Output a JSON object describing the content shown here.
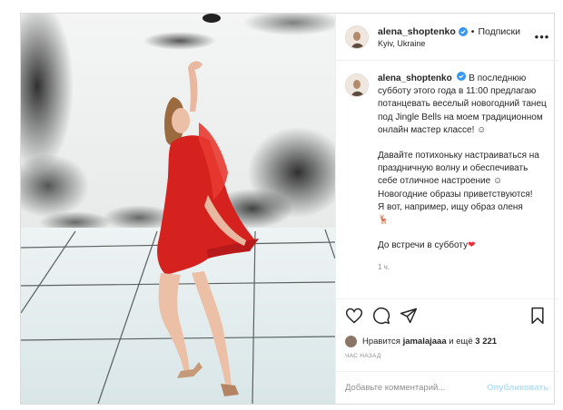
{
  "post": {
    "username": "alena_shoptenko",
    "separator": "•",
    "follow_label": "Подписки",
    "location": "Kyiv, Ukraine",
    "more_label": "•••",
    "caption_lines": [
      "В последнюю субботу этого года в 11:00 предлагаю потанцевать веселый новогодний танец под Jingle Bells на моем традиционном онлайн мастер классе! ☺",
      "",
      "Давайте потихоньку настраиваться на праздничную волну и обеспечивать себе отличное настроение ☺",
      "Новогодние образы приветствуются!",
      "Я вот, например, ищу образ оленя",
      "🦌",
      "",
      "До встречи в субботу"
    ],
    "caption_heart": "❤",
    "caption_age": "1 ч.",
    "likes_prefix": "Нравится",
    "likes_user": "jamalajaaa",
    "likes_and": "и ещё",
    "likes_count": "3 221",
    "time_ago": "ЧАС НАЗАД",
    "comment_placeholder": "Добавьте комментарий...",
    "publish_label": "Опубликовать"
  },
  "colors": {
    "verified": "#3897f0",
    "dress": "#d6221f",
    "publish_disabled": "#b2dffc"
  },
  "icons": [
    "verified-icon",
    "more-icon",
    "like-icon",
    "comment-icon",
    "share-icon",
    "save-icon"
  ]
}
